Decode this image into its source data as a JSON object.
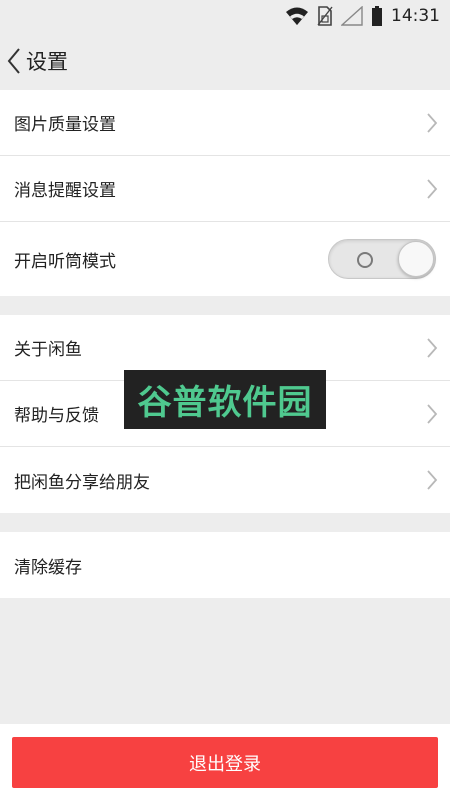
{
  "status_bar": {
    "time": "14:31",
    "icons": [
      "wifi-icon",
      "sim-card-icon",
      "signal-icon",
      "battery-icon"
    ]
  },
  "nav": {
    "back_icon": "chevron-left-icon",
    "title": "设置"
  },
  "groups": [
    {
      "items": [
        {
          "label": "图片质量设置",
          "type": "link"
        },
        {
          "label": "消息提醒设置",
          "type": "link"
        },
        {
          "label": "开启听筒模式",
          "type": "toggle",
          "toggle_on": false
        }
      ]
    },
    {
      "items": [
        {
          "label": "关于闲鱼",
          "type": "link"
        },
        {
          "label": "帮助与反馈",
          "type": "link"
        },
        {
          "label": "把闲鱼分享给朋友",
          "type": "link"
        }
      ]
    },
    {
      "items": [
        {
          "label": "清除缓存",
          "type": "plain"
        }
      ]
    }
  ],
  "watermark": {
    "text": "谷普软件园"
  },
  "logout": {
    "label": "退出登录"
  },
  "colors": {
    "logout_bg": "#f74141",
    "page_bg": "#ededed",
    "watermark_text": "#4fc98f"
  }
}
